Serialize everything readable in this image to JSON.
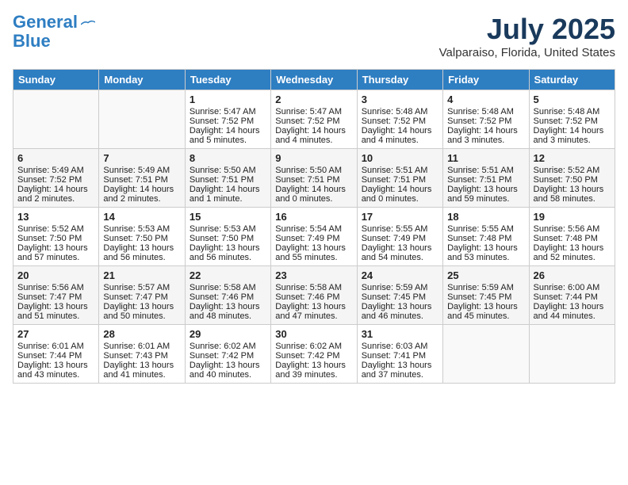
{
  "header": {
    "logo_line1": "General",
    "logo_line2": "Blue",
    "month_year": "July 2025",
    "location": "Valparaiso, Florida, United States"
  },
  "weekdays": [
    "Sunday",
    "Monday",
    "Tuesday",
    "Wednesday",
    "Thursday",
    "Friday",
    "Saturday"
  ],
  "weeks": [
    [
      {
        "day": "",
        "info": ""
      },
      {
        "day": "",
        "info": ""
      },
      {
        "day": "1",
        "info": "Sunrise: 5:47 AM\nSunset: 7:52 PM\nDaylight: 14 hours\nand 5 minutes."
      },
      {
        "day": "2",
        "info": "Sunrise: 5:47 AM\nSunset: 7:52 PM\nDaylight: 14 hours\nand 4 minutes."
      },
      {
        "day": "3",
        "info": "Sunrise: 5:48 AM\nSunset: 7:52 PM\nDaylight: 14 hours\nand 4 minutes."
      },
      {
        "day": "4",
        "info": "Sunrise: 5:48 AM\nSunset: 7:52 PM\nDaylight: 14 hours\nand 3 minutes."
      },
      {
        "day": "5",
        "info": "Sunrise: 5:48 AM\nSunset: 7:52 PM\nDaylight: 14 hours\nand 3 minutes."
      }
    ],
    [
      {
        "day": "6",
        "info": "Sunrise: 5:49 AM\nSunset: 7:52 PM\nDaylight: 14 hours\nand 2 minutes."
      },
      {
        "day": "7",
        "info": "Sunrise: 5:49 AM\nSunset: 7:51 PM\nDaylight: 14 hours\nand 2 minutes."
      },
      {
        "day": "8",
        "info": "Sunrise: 5:50 AM\nSunset: 7:51 PM\nDaylight: 14 hours\nand 1 minute."
      },
      {
        "day": "9",
        "info": "Sunrise: 5:50 AM\nSunset: 7:51 PM\nDaylight: 14 hours\nand 0 minutes."
      },
      {
        "day": "10",
        "info": "Sunrise: 5:51 AM\nSunset: 7:51 PM\nDaylight: 14 hours\nand 0 minutes."
      },
      {
        "day": "11",
        "info": "Sunrise: 5:51 AM\nSunset: 7:51 PM\nDaylight: 13 hours\nand 59 minutes."
      },
      {
        "day": "12",
        "info": "Sunrise: 5:52 AM\nSunset: 7:50 PM\nDaylight: 13 hours\nand 58 minutes."
      }
    ],
    [
      {
        "day": "13",
        "info": "Sunrise: 5:52 AM\nSunset: 7:50 PM\nDaylight: 13 hours\nand 57 minutes."
      },
      {
        "day": "14",
        "info": "Sunrise: 5:53 AM\nSunset: 7:50 PM\nDaylight: 13 hours\nand 56 minutes."
      },
      {
        "day": "15",
        "info": "Sunrise: 5:53 AM\nSunset: 7:50 PM\nDaylight: 13 hours\nand 56 minutes."
      },
      {
        "day": "16",
        "info": "Sunrise: 5:54 AM\nSunset: 7:49 PM\nDaylight: 13 hours\nand 55 minutes."
      },
      {
        "day": "17",
        "info": "Sunrise: 5:55 AM\nSunset: 7:49 PM\nDaylight: 13 hours\nand 54 minutes."
      },
      {
        "day": "18",
        "info": "Sunrise: 5:55 AM\nSunset: 7:48 PM\nDaylight: 13 hours\nand 53 minutes."
      },
      {
        "day": "19",
        "info": "Sunrise: 5:56 AM\nSunset: 7:48 PM\nDaylight: 13 hours\nand 52 minutes."
      }
    ],
    [
      {
        "day": "20",
        "info": "Sunrise: 5:56 AM\nSunset: 7:47 PM\nDaylight: 13 hours\nand 51 minutes."
      },
      {
        "day": "21",
        "info": "Sunrise: 5:57 AM\nSunset: 7:47 PM\nDaylight: 13 hours\nand 50 minutes."
      },
      {
        "day": "22",
        "info": "Sunrise: 5:58 AM\nSunset: 7:46 PM\nDaylight: 13 hours\nand 48 minutes."
      },
      {
        "day": "23",
        "info": "Sunrise: 5:58 AM\nSunset: 7:46 PM\nDaylight: 13 hours\nand 47 minutes."
      },
      {
        "day": "24",
        "info": "Sunrise: 5:59 AM\nSunset: 7:45 PM\nDaylight: 13 hours\nand 46 minutes."
      },
      {
        "day": "25",
        "info": "Sunrise: 5:59 AM\nSunset: 7:45 PM\nDaylight: 13 hours\nand 45 minutes."
      },
      {
        "day": "26",
        "info": "Sunrise: 6:00 AM\nSunset: 7:44 PM\nDaylight: 13 hours\nand 44 minutes."
      }
    ],
    [
      {
        "day": "27",
        "info": "Sunrise: 6:01 AM\nSunset: 7:44 PM\nDaylight: 13 hours\nand 43 minutes."
      },
      {
        "day": "28",
        "info": "Sunrise: 6:01 AM\nSunset: 7:43 PM\nDaylight: 13 hours\nand 41 minutes."
      },
      {
        "day": "29",
        "info": "Sunrise: 6:02 AM\nSunset: 7:42 PM\nDaylight: 13 hours\nand 40 minutes."
      },
      {
        "day": "30",
        "info": "Sunrise: 6:02 AM\nSunset: 7:42 PM\nDaylight: 13 hours\nand 39 minutes."
      },
      {
        "day": "31",
        "info": "Sunrise: 6:03 AM\nSunset: 7:41 PM\nDaylight: 13 hours\nand 37 minutes."
      },
      {
        "day": "",
        "info": ""
      },
      {
        "day": "",
        "info": ""
      }
    ]
  ]
}
